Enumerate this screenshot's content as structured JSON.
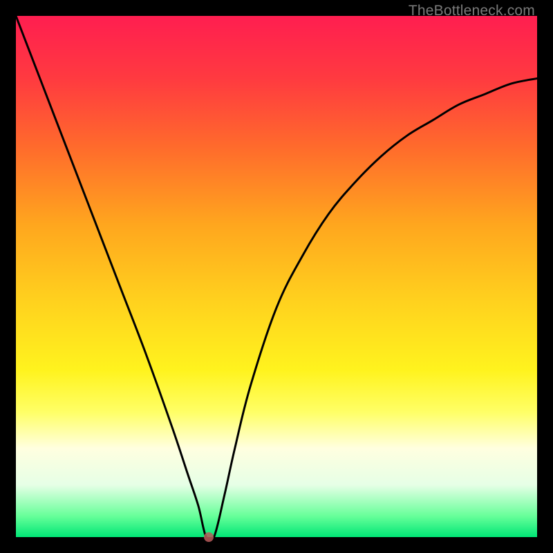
{
  "watermark": "TheBottleneck.com",
  "chart_data": {
    "type": "line",
    "title": "",
    "xlabel": "",
    "ylabel": "",
    "xlim": [
      0,
      100
    ],
    "ylim": [
      0,
      100
    ],
    "grid": false,
    "legend": false,
    "series": [
      {
        "name": "curve",
        "x": [
          0,
          5,
          10,
          15,
          20,
          25,
          30,
          33,
          35,
          36.5,
          38,
          40,
          42,
          45,
          50,
          55,
          60,
          65,
          70,
          75,
          80,
          85,
          90,
          95,
          100
        ],
        "y": [
          100,
          87,
          74,
          61,
          48,
          35,
          21,
          12,
          6,
          0,
          0,
          8,
          17,
          29,
          44,
          54,
          62,
          68,
          73,
          77,
          80,
          83,
          85,
          87,
          88
        ]
      }
    ],
    "marker": {
      "x": 37,
      "y": 0,
      "color": "#b85a5a"
    },
    "background": "rainbow-vertical-gradient",
    "gradient_stops": [
      {
        "pos": 0.0,
        "color": "#ff1e50"
      },
      {
        "pos": 0.25,
        "color": "#ff6a2c"
      },
      {
        "pos": 0.55,
        "color": "#ffd21e"
      },
      {
        "pos": 0.76,
        "color": "#ffff66"
      },
      {
        "pos": 0.9,
        "color": "#e6ffe6"
      },
      {
        "pos": 1.0,
        "color": "#00e676"
      }
    ]
  }
}
